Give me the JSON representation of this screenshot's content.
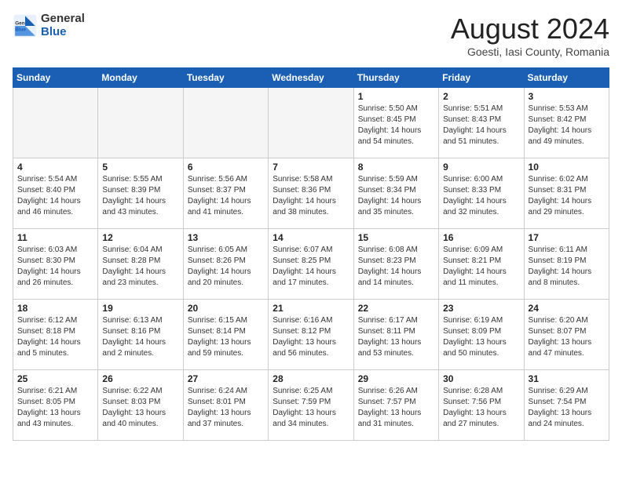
{
  "header": {
    "logo_general": "General",
    "logo_blue": "Blue",
    "month_title": "August 2024",
    "location": "Goesti, Iasi County, Romania"
  },
  "weekdays": [
    "Sunday",
    "Monday",
    "Tuesday",
    "Wednesday",
    "Thursday",
    "Friday",
    "Saturday"
  ],
  "weeks": [
    [
      {
        "day": "",
        "info": ""
      },
      {
        "day": "",
        "info": ""
      },
      {
        "day": "",
        "info": ""
      },
      {
        "day": "",
        "info": ""
      },
      {
        "day": "1",
        "info": "Sunrise: 5:50 AM\nSunset: 8:45 PM\nDaylight: 14 hours\nand 54 minutes."
      },
      {
        "day": "2",
        "info": "Sunrise: 5:51 AM\nSunset: 8:43 PM\nDaylight: 14 hours\nand 51 minutes."
      },
      {
        "day": "3",
        "info": "Sunrise: 5:53 AM\nSunset: 8:42 PM\nDaylight: 14 hours\nand 49 minutes."
      }
    ],
    [
      {
        "day": "4",
        "info": "Sunrise: 5:54 AM\nSunset: 8:40 PM\nDaylight: 14 hours\nand 46 minutes."
      },
      {
        "day": "5",
        "info": "Sunrise: 5:55 AM\nSunset: 8:39 PM\nDaylight: 14 hours\nand 43 minutes."
      },
      {
        "day": "6",
        "info": "Sunrise: 5:56 AM\nSunset: 8:37 PM\nDaylight: 14 hours\nand 41 minutes."
      },
      {
        "day": "7",
        "info": "Sunrise: 5:58 AM\nSunset: 8:36 PM\nDaylight: 14 hours\nand 38 minutes."
      },
      {
        "day": "8",
        "info": "Sunrise: 5:59 AM\nSunset: 8:34 PM\nDaylight: 14 hours\nand 35 minutes."
      },
      {
        "day": "9",
        "info": "Sunrise: 6:00 AM\nSunset: 8:33 PM\nDaylight: 14 hours\nand 32 minutes."
      },
      {
        "day": "10",
        "info": "Sunrise: 6:02 AM\nSunset: 8:31 PM\nDaylight: 14 hours\nand 29 minutes."
      }
    ],
    [
      {
        "day": "11",
        "info": "Sunrise: 6:03 AM\nSunset: 8:30 PM\nDaylight: 14 hours\nand 26 minutes."
      },
      {
        "day": "12",
        "info": "Sunrise: 6:04 AM\nSunset: 8:28 PM\nDaylight: 14 hours\nand 23 minutes."
      },
      {
        "day": "13",
        "info": "Sunrise: 6:05 AM\nSunset: 8:26 PM\nDaylight: 14 hours\nand 20 minutes."
      },
      {
        "day": "14",
        "info": "Sunrise: 6:07 AM\nSunset: 8:25 PM\nDaylight: 14 hours\nand 17 minutes."
      },
      {
        "day": "15",
        "info": "Sunrise: 6:08 AM\nSunset: 8:23 PM\nDaylight: 14 hours\nand 14 minutes."
      },
      {
        "day": "16",
        "info": "Sunrise: 6:09 AM\nSunset: 8:21 PM\nDaylight: 14 hours\nand 11 minutes."
      },
      {
        "day": "17",
        "info": "Sunrise: 6:11 AM\nSunset: 8:19 PM\nDaylight: 14 hours\nand 8 minutes."
      }
    ],
    [
      {
        "day": "18",
        "info": "Sunrise: 6:12 AM\nSunset: 8:18 PM\nDaylight: 14 hours\nand 5 minutes."
      },
      {
        "day": "19",
        "info": "Sunrise: 6:13 AM\nSunset: 8:16 PM\nDaylight: 14 hours\nand 2 minutes."
      },
      {
        "day": "20",
        "info": "Sunrise: 6:15 AM\nSunset: 8:14 PM\nDaylight: 13 hours\nand 59 minutes."
      },
      {
        "day": "21",
        "info": "Sunrise: 6:16 AM\nSunset: 8:12 PM\nDaylight: 13 hours\nand 56 minutes."
      },
      {
        "day": "22",
        "info": "Sunrise: 6:17 AM\nSunset: 8:11 PM\nDaylight: 13 hours\nand 53 minutes."
      },
      {
        "day": "23",
        "info": "Sunrise: 6:19 AM\nSunset: 8:09 PM\nDaylight: 13 hours\nand 50 minutes."
      },
      {
        "day": "24",
        "info": "Sunrise: 6:20 AM\nSunset: 8:07 PM\nDaylight: 13 hours\nand 47 minutes."
      }
    ],
    [
      {
        "day": "25",
        "info": "Sunrise: 6:21 AM\nSunset: 8:05 PM\nDaylight: 13 hours\nand 43 minutes."
      },
      {
        "day": "26",
        "info": "Sunrise: 6:22 AM\nSunset: 8:03 PM\nDaylight: 13 hours\nand 40 minutes."
      },
      {
        "day": "27",
        "info": "Sunrise: 6:24 AM\nSunset: 8:01 PM\nDaylight: 13 hours\nand 37 minutes."
      },
      {
        "day": "28",
        "info": "Sunrise: 6:25 AM\nSunset: 7:59 PM\nDaylight: 13 hours\nand 34 minutes."
      },
      {
        "day": "29",
        "info": "Sunrise: 6:26 AM\nSunset: 7:57 PM\nDaylight: 13 hours\nand 31 minutes."
      },
      {
        "day": "30",
        "info": "Sunrise: 6:28 AM\nSunset: 7:56 PM\nDaylight: 13 hours\nand 27 minutes."
      },
      {
        "day": "31",
        "info": "Sunrise: 6:29 AM\nSunset: 7:54 PM\nDaylight: 13 hours\nand 24 minutes."
      }
    ]
  ]
}
